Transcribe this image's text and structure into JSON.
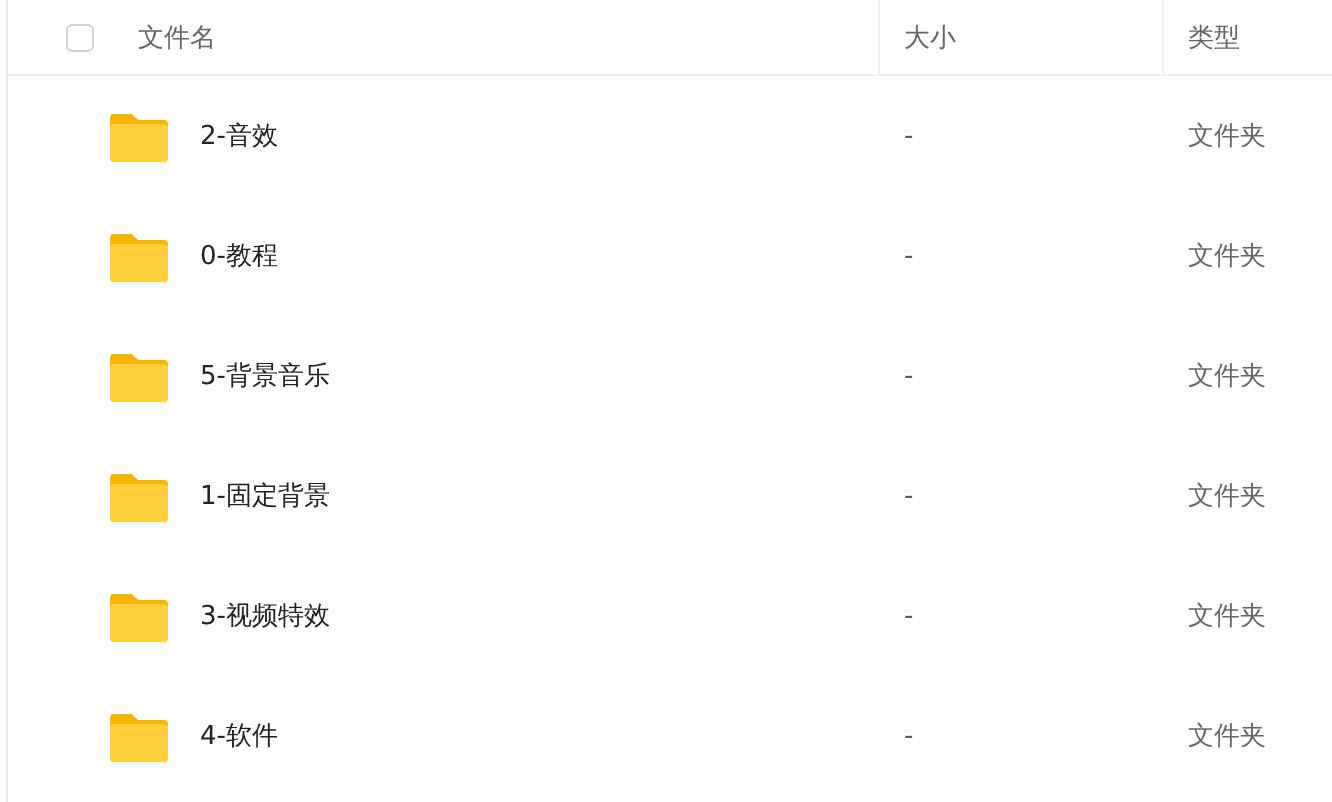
{
  "table": {
    "select_all": {
      "checked": false
    },
    "columns": [
      "文件名",
      "大小",
      "类型"
    ],
    "rows": [
      {
        "name": "2-音效",
        "size": "-",
        "type": "文件夹"
      },
      {
        "name": "0-教程",
        "size": "-",
        "type": "文件夹"
      },
      {
        "name": "5-背景音乐",
        "size": "-",
        "type": "文件夹"
      },
      {
        "name": "1-固定背景",
        "size": "-",
        "type": "文件夹"
      },
      {
        "name": "3-视频特效",
        "size": "-",
        "type": "文件夹"
      },
      {
        "name": "4-软件",
        "size": "-",
        "type": "文件夹"
      }
    ]
  }
}
